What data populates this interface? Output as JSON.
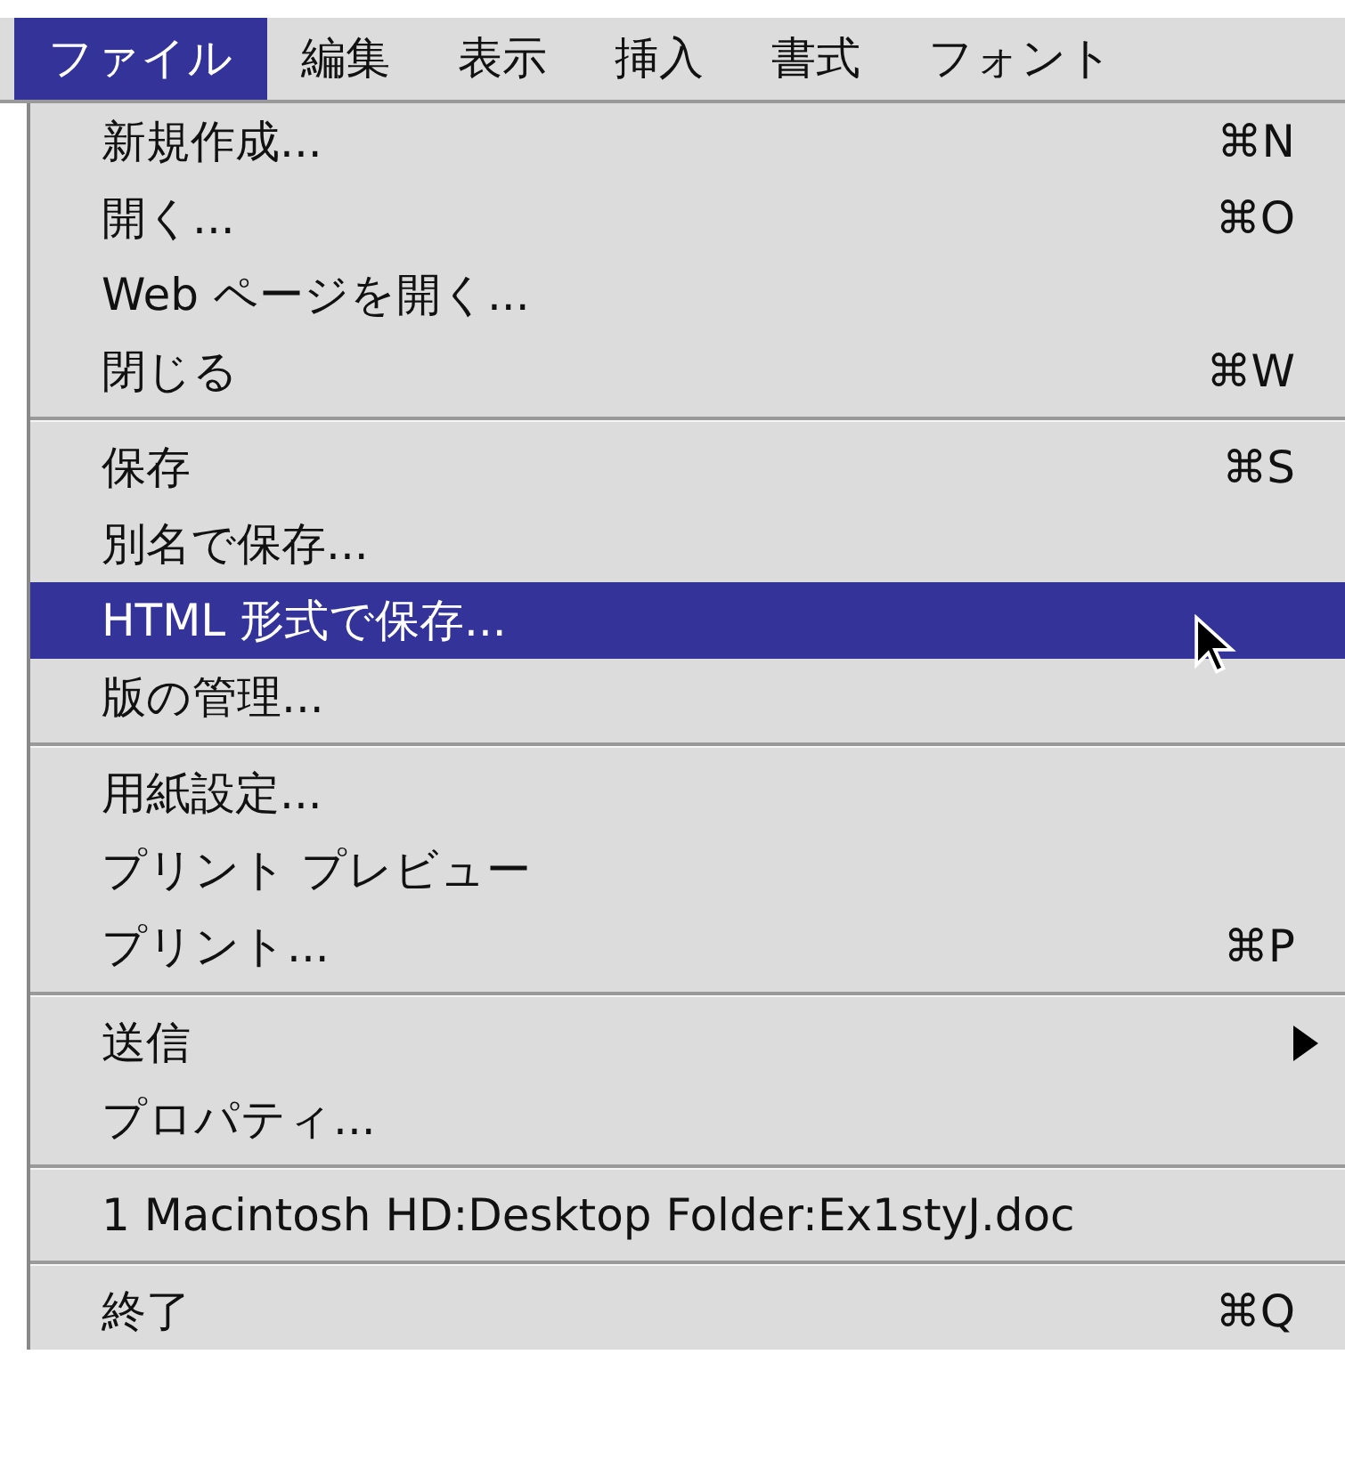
{
  "menubar": [
    {
      "label": "ファイル",
      "selected": true
    },
    {
      "label": "編集",
      "selected": false
    },
    {
      "label": "表示",
      "selected": false
    },
    {
      "label": "挿入",
      "selected": false
    },
    {
      "label": "書式",
      "selected": false
    },
    {
      "label": "フォント",
      "selected": false
    }
  ],
  "menu": {
    "groups": [
      [
        {
          "kind": "item",
          "label": "新規作成...",
          "shortcut": "⌘N",
          "selected": false
        },
        {
          "kind": "item",
          "label": "開く...",
          "shortcut": "⌘O",
          "selected": false
        },
        {
          "kind": "item",
          "label": "Web ページを開く...",
          "selected": false
        },
        {
          "kind": "item",
          "label": "閉じる",
          "shortcut": "⌘W",
          "selected": false
        }
      ],
      [
        {
          "kind": "item",
          "label": "保存",
          "shortcut": "⌘S",
          "selected": false
        },
        {
          "kind": "item",
          "label": "別名で保存...",
          "selected": false
        },
        {
          "kind": "item",
          "label": "HTML 形式で保存...",
          "selected": true
        },
        {
          "kind": "item",
          "label": "版の管理...",
          "selected": false
        }
      ],
      [
        {
          "kind": "item",
          "label": "用紙設定...",
          "selected": false
        },
        {
          "kind": "item",
          "label": "プリント プレビュー",
          "selected": false
        },
        {
          "kind": "item",
          "label": "プリント...",
          "shortcut": "⌘P",
          "selected": false
        }
      ],
      [
        {
          "kind": "submenu",
          "label": "送信",
          "selected": false
        },
        {
          "kind": "item",
          "label": "プロパティ...",
          "selected": false
        }
      ],
      [
        {
          "kind": "item",
          "label": "1 Macintosh HD:Desktop Folder:Ex1styJ.doc",
          "selected": false
        }
      ],
      [
        {
          "kind": "item",
          "label": "終了",
          "shortcut": "⌘Q",
          "selected": false
        }
      ]
    ]
  }
}
